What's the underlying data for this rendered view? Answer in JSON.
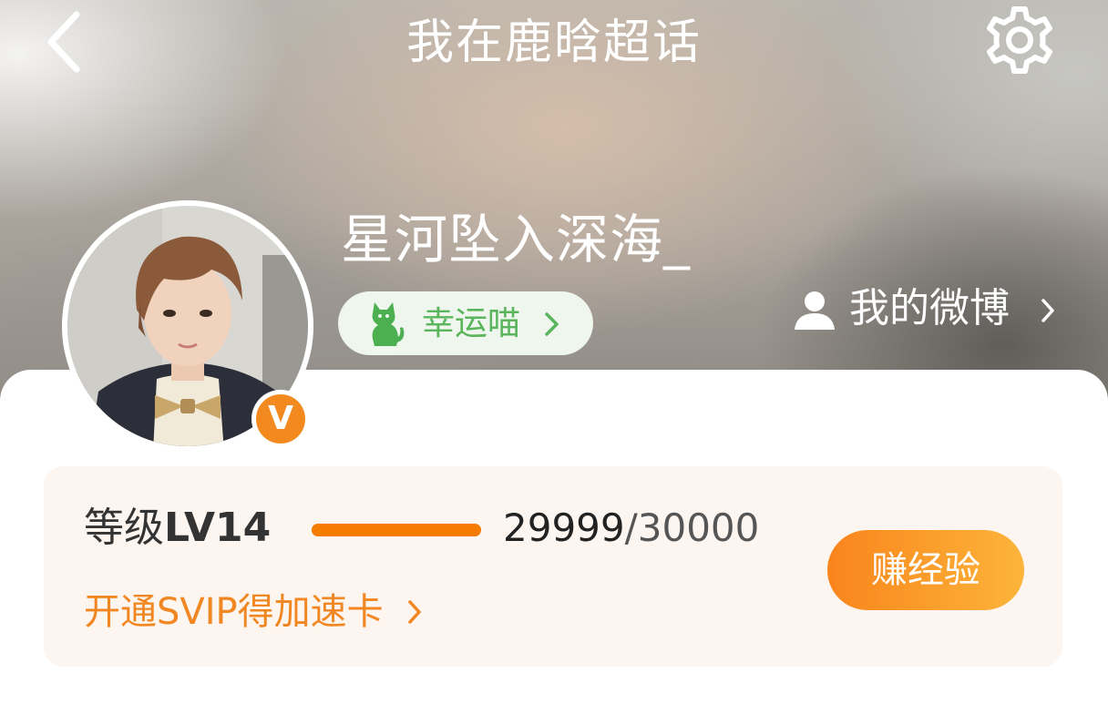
{
  "nav": {
    "title": "我在鹿晗超话",
    "back_icon": "chevron-left-icon",
    "settings_icon": "gear-icon"
  },
  "profile": {
    "username": "星河坠入深海_",
    "badge_label": "幸运喵",
    "badge_icon": "cat-icon",
    "my_weibo_label": "我的微博",
    "my_weibo_icon": "person-icon",
    "vip_mark": "V"
  },
  "level": {
    "prefix": "等级",
    "level": "LV14",
    "current_exp": "29999",
    "total_exp": "/30000",
    "progress": 0.99997,
    "earn_button": "赚经验",
    "svip_link": "开通SVIP得加速卡"
  },
  "colors": {
    "accent": "#f57c00",
    "badge_green": "#5bb55d",
    "card_bg": "#fdf5ef",
    "svip_text": "#f18722"
  }
}
